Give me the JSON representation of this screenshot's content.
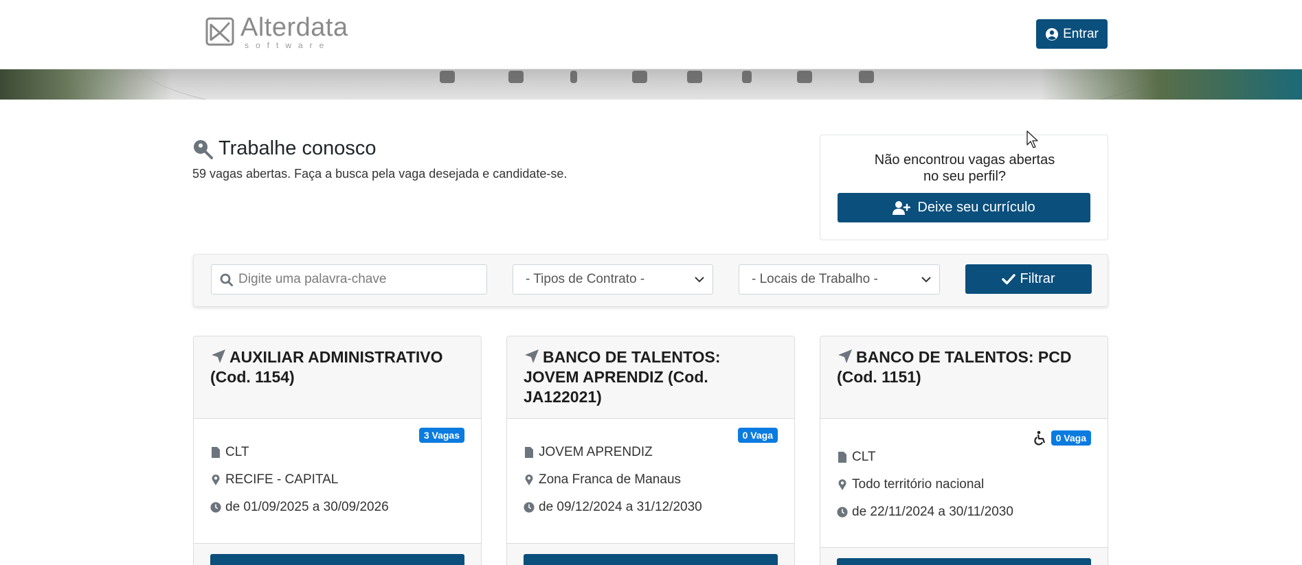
{
  "header": {
    "logo_name": "Alterdata",
    "logo_sub": "software",
    "login_label": "Entrar"
  },
  "intro": {
    "title": "Trabalhe conosco",
    "subtitle": "59 vagas abertas. Faça a busca pela vaga desejada e candidate-se."
  },
  "cv_card": {
    "line1": "Não encontrou vagas abertas",
    "line2": "no seu perfil?",
    "button_label": "Deixe seu currículo"
  },
  "filters": {
    "search_placeholder": "Digite uma palavra-chave",
    "contract_selected": "- Tipos de Contrato -",
    "location_selected": "- Locais de Trabalho -",
    "filter_label": "Filtrar"
  },
  "jobs": [
    {
      "title": "AUXILIAR ADMINISTRATIVO (Cod. 1154)",
      "badge": "3 Vagas",
      "contract": "CLT",
      "location": "RECIFE - CAPITAL",
      "period": "de 01/09/2025 a 30/09/2026",
      "accessible": false
    },
    {
      "title": "BANCO DE TALENTOS: JOVEM APRENDIZ (Cod. JA122021)",
      "badge": "0 Vaga",
      "contract": "JOVEM APRENDIZ",
      "location": "Zona Franca de Manaus",
      "period": "de 09/12/2024 a 31/12/2030",
      "accessible": false
    },
    {
      "title": "BANCO DE TALENTOS: PCD (Cod. 1151)",
      "badge": "0 Vaga",
      "contract": "CLT",
      "location": "Todo território nacional",
      "period": "de 22/11/2024 a 30/11/2030",
      "accessible": true
    }
  ],
  "colors": {
    "primary": "#0b4f7c",
    "badge": "#0b7be0"
  }
}
